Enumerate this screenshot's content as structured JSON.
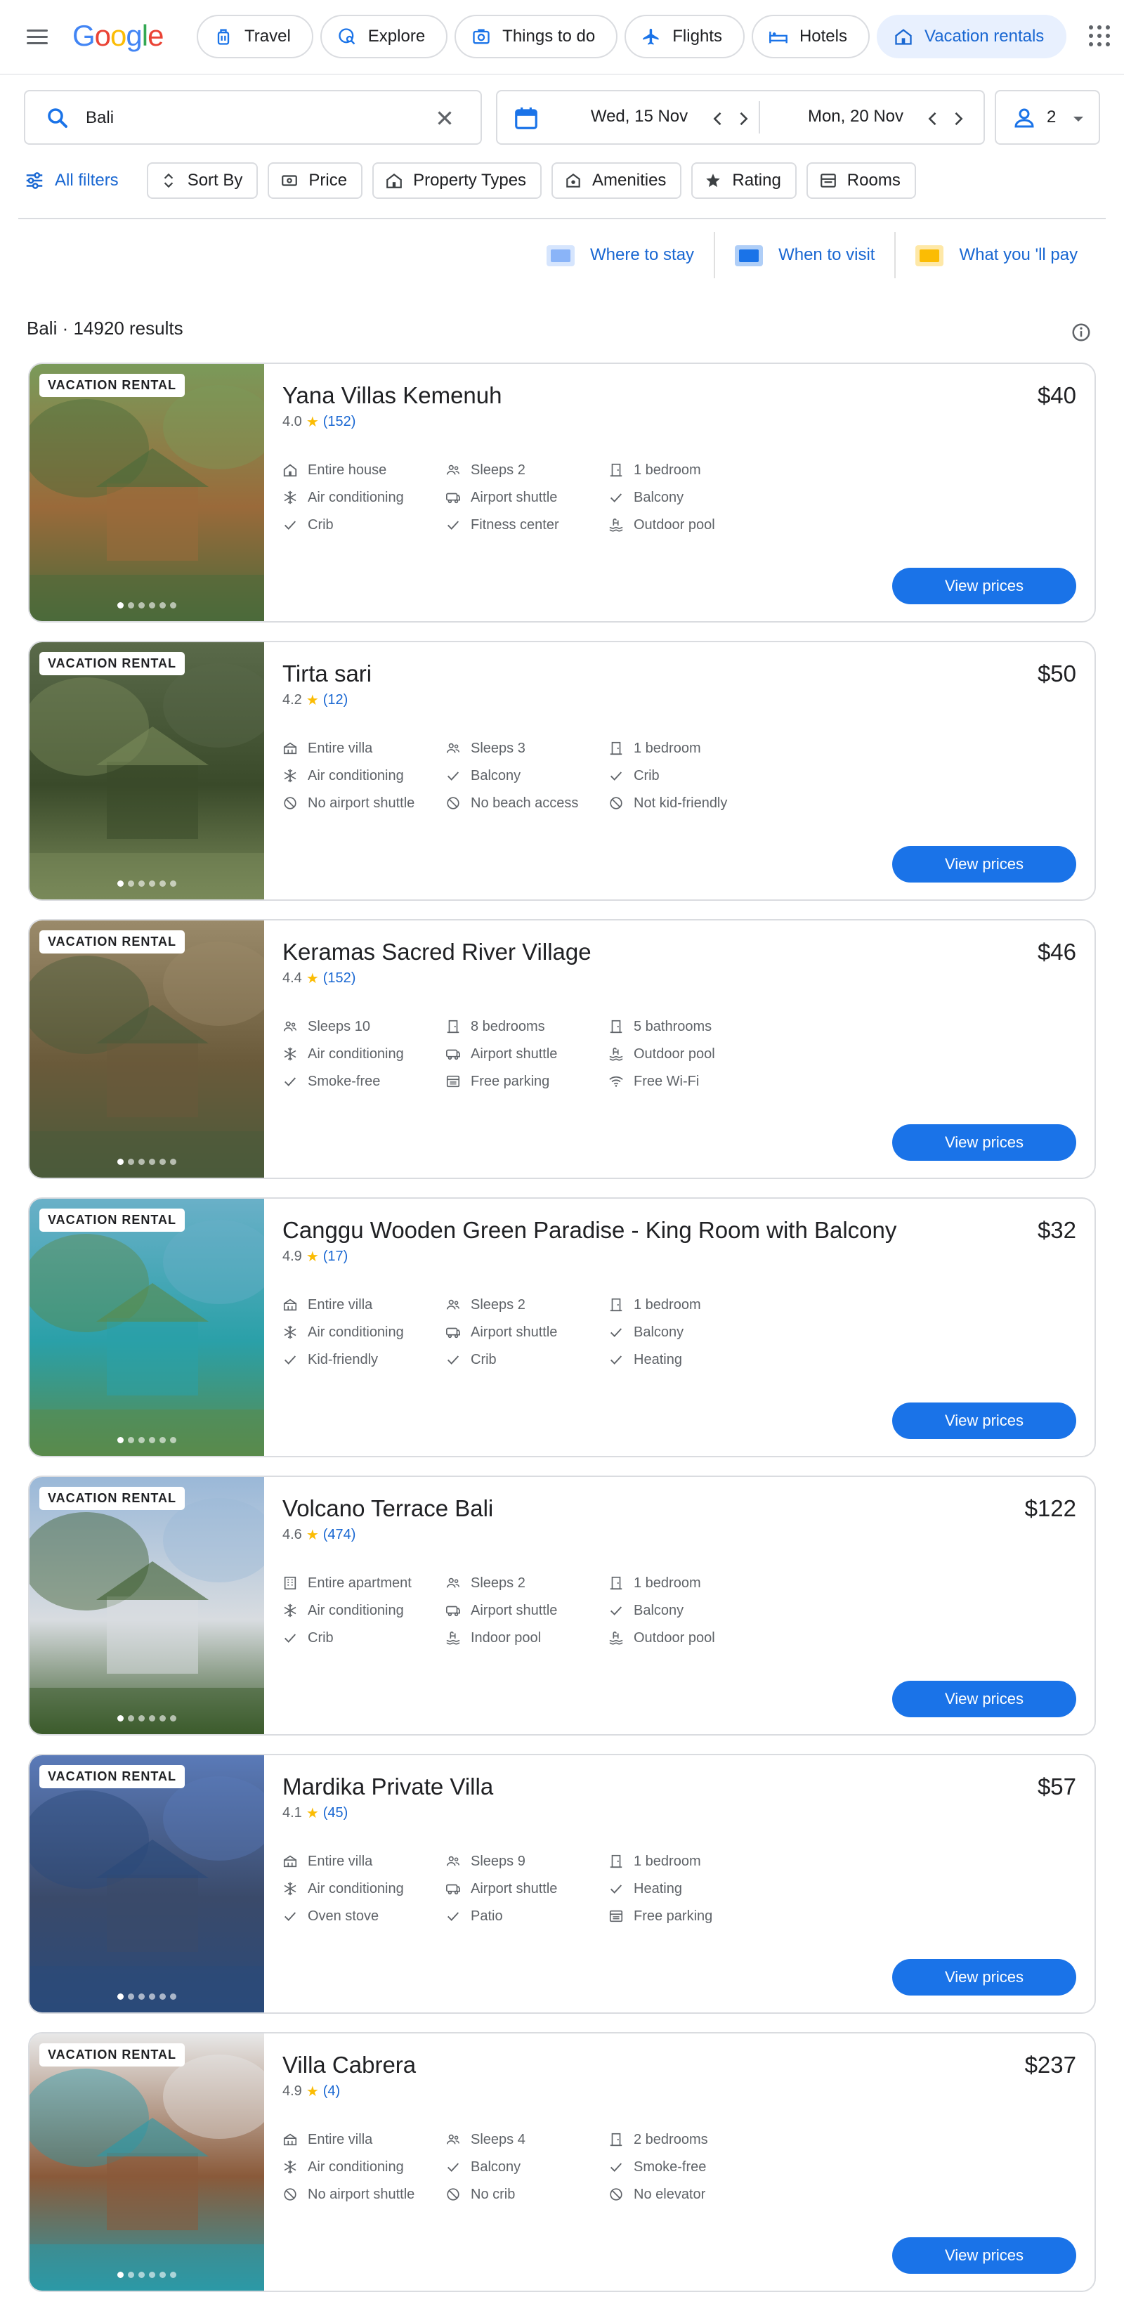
{
  "header": {
    "logo": [
      "G",
      "o",
      "o",
      "g",
      "l",
      "e"
    ],
    "logo_colors": [
      "#4285F4",
      "#EA4335",
      "#FBBC05",
      "#4285F4",
      "#34A853",
      "#EA4335"
    ],
    "nav": [
      {
        "label": "Travel",
        "icon": "suitcase-icon"
      },
      {
        "label": "Explore",
        "icon": "explore-icon"
      },
      {
        "label": "Things to do",
        "icon": "camera-icon"
      },
      {
        "label": "Flights",
        "icon": "plane-icon"
      },
      {
        "label": "Hotels",
        "icon": "bed-icon"
      },
      {
        "label": "Vacation rentals",
        "icon": "house-icon",
        "active": true
      }
    ]
  },
  "search": {
    "value": "Bali",
    "check_in": "Wed, 15 Nov",
    "check_out": "Mon, 20 Nov",
    "guests": "2"
  },
  "filters": {
    "all_filters": "All filters",
    "chips": [
      {
        "label": "Sort By",
        "icon": "sort-icon"
      },
      {
        "label": "Price",
        "icon": "price-icon"
      },
      {
        "label": "Property Types",
        "icon": "house-icon"
      },
      {
        "label": "Amenities",
        "icon": "amenities-icon"
      },
      {
        "label": "Rating",
        "icon": "star-icon"
      },
      {
        "label": "Rooms",
        "icon": "rooms-icon"
      }
    ]
  },
  "insights": [
    {
      "label": "Where to stay",
      "color": "#8ab4f8"
    },
    {
      "label": "When to visit",
      "color": "#1a73e8"
    },
    {
      "label": "What you 'll pay",
      "color": "#fbbc04"
    }
  ],
  "results": {
    "location": "Bali",
    "count": "· 14920 results"
  },
  "badge_label": "VACATION RENTAL",
  "view_prices_label": "View prices",
  "star_glyph": "★",
  "listings": [
    {
      "name": "Yana Villas Kemenuh",
      "price": "$40",
      "rating": "4.0",
      "reviews": "(152)",
      "colors": [
        "#7a9a5a",
        "#9a6a3a",
        "#4a6a3a"
      ],
      "features": [
        {
          "label": "Entire house",
          "icon": "house-icon"
        },
        {
          "label": "Sleeps 2",
          "icon": "people-icon"
        },
        {
          "label": "1 bedroom",
          "icon": "door-icon"
        },
        {
          "label": "Air conditioning",
          "icon": "snowflake-icon"
        },
        {
          "label": "Airport shuttle",
          "icon": "shuttle-icon"
        },
        {
          "label": "Balcony",
          "icon": "check-icon"
        },
        {
          "label": "Crib",
          "icon": "check-icon"
        },
        {
          "label": "Fitness center",
          "icon": "check-icon"
        },
        {
          "label": "Outdoor pool",
          "icon": "pool-icon"
        }
      ]
    },
    {
      "name": "Tirta sari",
      "price": "$50",
      "rating": "4.2",
      "reviews": "(12)",
      "colors": [
        "#5a6a4a",
        "#3a4a2a",
        "#7a8a5a"
      ],
      "features": [
        {
          "label": "Entire villa",
          "icon": "villa-icon"
        },
        {
          "label": "Sleeps 3",
          "icon": "people-icon"
        },
        {
          "label": "1 bedroom",
          "icon": "door-icon"
        },
        {
          "label": "Air conditioning",
          "icon": "snowflake-icon"
        },
        {
          "label": "Balcony",
          "icon": "check-icon"
        },
        {
          "label": "Crib",
          "icon": "check-icon"
        },
        {
          "label": "No airport shuttle",
          "icon": "no-icon"
        },
        {
          "label": "No beach access",
          "icon": "no-icon"
        },
        {
          "label": "Not kid-friendly",
          "icon": "no-icon"
        }
      ]
    },
    {
      "name": "Keramas Sacred River Village",
      "price": "$46",
      "rating": "4.4",
      "reviews": "(152)",
      "colors": [
        "#9a8a6a",
        "#6a5a3a",
        "#4a5a3a"
      ],
      "features": [
        {
          "label": "Sleeps 10",
          "icon": "people-icon"
        },
        {
          "label": "8 bedrooms",
          "icon": "door-icon"
        },
        {
          "label": "5 bathrooms",
          "icon": "door-icon"
        },
        {
          "label": "Air conditioning",
          "icon": "snowflake-icon"
        },
        {
          "label": "Airport shuttle",
          "icon": "shuttle-icon"
        },
        {
          "label": "Outdoor pool",
          "icon": "pool-icon"
        },
        {
          "label": "Smoke-free",
          "icon": "check-icon"
        },
        {
          "label": "Free parking",
          "icon": "parking-icon"
        },
        {
          "label": "Free Wi-Fi",
          "icon": "wifi-icon"
        }
      ]
    },
    {
      "name": "Canggu Wooden Green Paradise - King Room with Balcony",
      "price": "$32",
      "rating": "4.9",
      "reviews": "(17)",
      "colors": [
        "#6ab0c8",
        "#2aa0a8",
        "#5a8a4a"
      ],
      "features": [
        {
          "label": "Entire villa",
          "icon": "villa-icon"
        },
        {
          "label": "Sleeps 2",
          "icon": "people-icon"
        },
        {
          "label": "1 bedroom",
          "icon": "door-icon"
        },
        {
          "label": "Air conditioning",
          "icon": "snowflake-icon"
        },
        {
          "label": "Airport shuttle",
          "icon": "shuttle-icon"
        },
        {
          "label": "Balcony",
          "icon": "check-icon"
        },
        {
          "label": "Kid-friendly",
          "icon": "check-icon"
        },
        {
          "label": "Crib",
          "icon": "check-icon"
        },
        {
          "label": "Heating",
          "icon": "check-icon"
        }
      ]
    },
    {
      "name": "Volcano Terrace Bali",
      "price": "$122",
      "rating": "4.6",
      "reviews": "(474)",
      "colors": [
        "#9ab8d8",
        "#d8dce0",
        "#3a5a2a"
      ],
      "features": [
        {
          "label": "Entire apartment",
          "icon": "apartment-icon"
        },
        {
          "label": "Sleeps 2",
          "icon": "people-icon"
        },
        {
          "label": "1 bedroom",
          "icon": "door-icon"
        },
        {
          "label": "Air conditioning",
          "icon": "snowflake-icon"
        },
        {
          "label": "Airport shuttle",
          "icon": "shuttle-icon"
        },
        {
          "label": "Balcony",
          "icon": "check-icon"
        },
        {
          "label": "Crib",
          "icon": "check-icon"
        },
        {
          "label": "Indoor pool",
          "icon": "pool-icon"
        },
        {
          "label": "Outdoor pool",
          "icon": "pool-icon"
        }
      ]
    },
    {
      "name": "Mardika Private Villa",
      "price": "$57",
      "rating": "4.1",
      "reviews": "(45)",
      "colors": [
        "#5a7ab8",
        "#3a4a6a",
        "#2a4a7a"
      ],
      "features": [
        {
          "label": "Entire villa",
          "icon": "villa-icon"
        },
        {
          "label": "Sleeps 9",
          "icon": "people-icon"
        },
        {
          "label": "1 bedroom",
          "icon": "door-icon"
        },
        {
          "label": "Air conditioning",
          "icon": "snowflake-icon"
        },
        {
          "label": "Airport shuttle",
          "icon": "shuttle-icon"
        },
        {
          "label": "Heating",
          "icon": "check-icon"
        },
        {
          "label": "Oven stove",
          "icon": "check-icon"
        },
        {
          "label": "Patio",
          "icon": "check-icon"
        },
        {
          "label": "Free parking",
          "icon": "parking-icon"
        }
      ]
    },
    {
      "name": "Villa Cabrera",
      "price": "$237",
      "rating": "4.9",
      "reviews": "(4)",
      "colors": [
        "#e8e8e8",
        "#8a5a3a",
        "#2a9aa8"
      ],
      "features": [
        {
          "label": "Entire villa",
          "icon": "villa-icon"
        },
        {
          "label": "Sleeps 4",
          "icon": "people-icon"
        },
        {
          "label": "2 bedrooms",
          "icon": "door-icon"
        },
        {
          "label": "Air conditioning",
          "icon": "snowflake-icon"
        },
        {
          "label": "Balcony",
          "icon": "check-icon"
        },
        {
          "label": "Smoke-free",
          "icon": "check-icon"
        },
        {
          "label": "No airport shuttle",
          "icon": "no-icon"
        },
        {
          "label": "No crib",
          "icon": "no-icon"
        },
        {
          "label": "No elevator",
          "icon": "no-icon"
        }
      ]
    }
  ]
}
